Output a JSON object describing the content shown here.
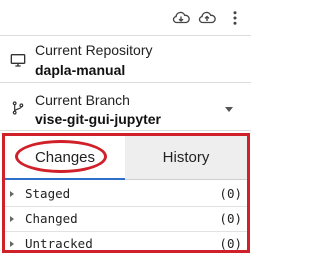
{
  "toolbar": {
    "icons": [
      "cloud-download-icon",
      "cloud-upload-icon",
      "more-vertical-icon"
    ]
  },
  "repository": {
    "caption": "Current Repository",
    "name": "dapla-manual",
    "icon": "monitor-icon"
  },
  "branch": {
    "caption": "Current Branch",
    "name": "vise-git-gui-jupyter",
    "icon": "git-branch-icon"
  },
  "tabs": [
    {
      "label": "Changes",
      "active": true
    },
    {
      "label": "History",
      "active": false
    }
  ],
  "sections": [
    {
      "label": "Staged",
      "count": "(0)"
    },
    {
      "label": "Changed",
      "count": "(0)"
    },
    {
      "label": "Untracked",
      "count": "(0)"
    }
  ],
  "colors": {
    "highlight": "#d0202a",
    "active_tab_underline": "#2f6fc9",
    "inactive_tab_bg": "#eeeeee"
  }
}
